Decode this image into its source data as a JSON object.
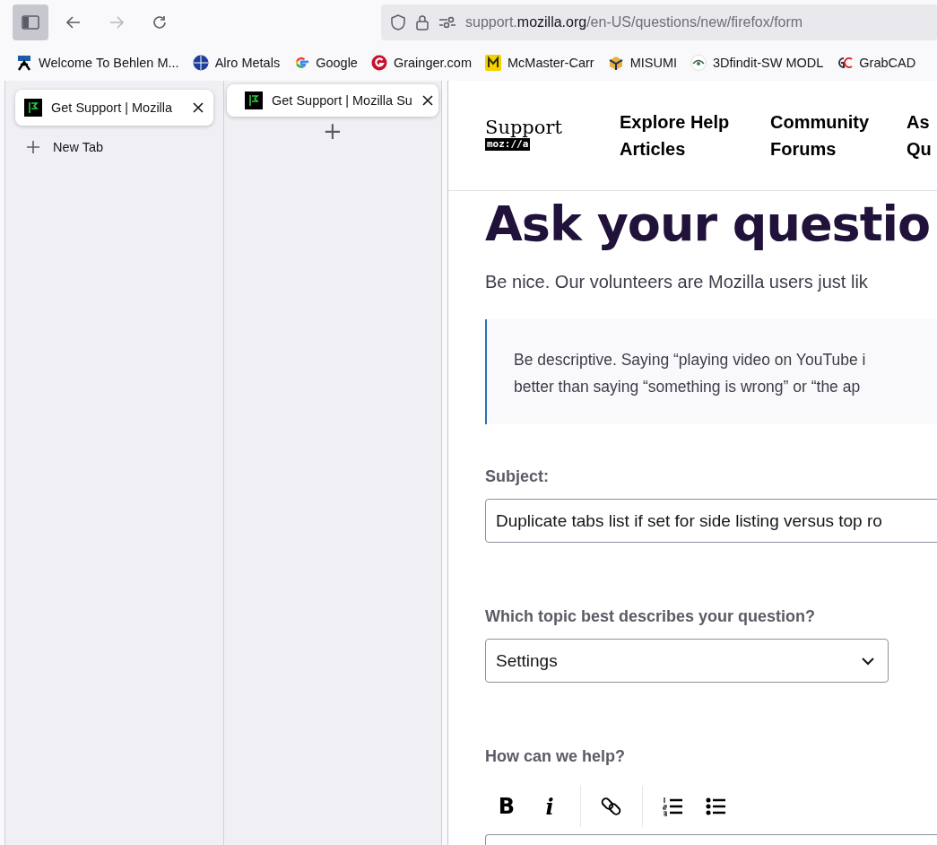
{
  "toolbar": {
    "url_host_prefix": "support.",
    "url_host": "mozilla.org",
    "url_path": "/en-US/questions/new/firefox/form",
    "sidebar_toggle_on": true,
    "forward_disabled": true
  },
  "bookmarks": [
    {
      "label": "Welcome To Behlen M...",
      "kind": "behlen"
    },
    {
      "label": "Alro Metals",
      "kind": "alro"
    },
    {
      "label": "Google",
      "kind": "google"
    },
    {
      "label": "Grainger.com",
      "kind": "grainger"
    },
    {
      "label": "McMaster-Carr",
      "kind": "mcmaster"
    },
    {
      "label": "MISUMI",
      "kind": "misumi"
    },
    {
      "label": "3Dfindit-SW MODL",
      "kind": "eye"
    },
    {
      "label": "GrabCAD",
      "kind": "grabcad"
    }
  ],
  "sidebar": {
    "tabs": [
      {
        "title": "Get Support | Mozilla",
        "selected": true
      }
    ],
    "new_tab": "New Tab"
  },
  "tab_panel": {
    "tabs": [
      {
        "title": "Get Support | Mozilla Su",
        "selected": true
      }
    ],
    "new_tab_symbol": "+"
  },
  "page": {
    "logo_title": "Support",
    "logo_brand": "moz://a",
    "nav": [
      {
        "line1": "Explore Help",
        "line2": "Articles"
      },
      {
        "line1": "Community",
        "line2": "Forums"
      },
      {
        "line1": "As",
        "line2": "Qu"
      }
    ],
    "heading": "Ask your questio",
    "intro": "Be nice. Our volunteers are Mozilla users just lik",
    "tip": [
      "Be descriptive. Saying “playing video on YouTube i",
      "better than saying “something is wrong” or “the ap"
    ],
    "subject_label": "Subject:",
    "subject_value": "Duplicate tabs list if set for side listing versus top ro",
    "topic_label": "Which topic best describes your question?",
    "topic_value": "Settings",
    "help_label": "How can we help?",
    "editor_tools": [
      {
        "kind": "bold",
        "label": "B"
      },
      {
        "kind": "italic",
        "label": "i"
      },
      {
        "kind": "sep"
      },
      {
        "kind": "link"
      },
      {
        "kind": "sep"
      },
      {
        "kind": "numbered"
      },
      {
        "kind": "bulleted"
      }
    ]
  }
}
